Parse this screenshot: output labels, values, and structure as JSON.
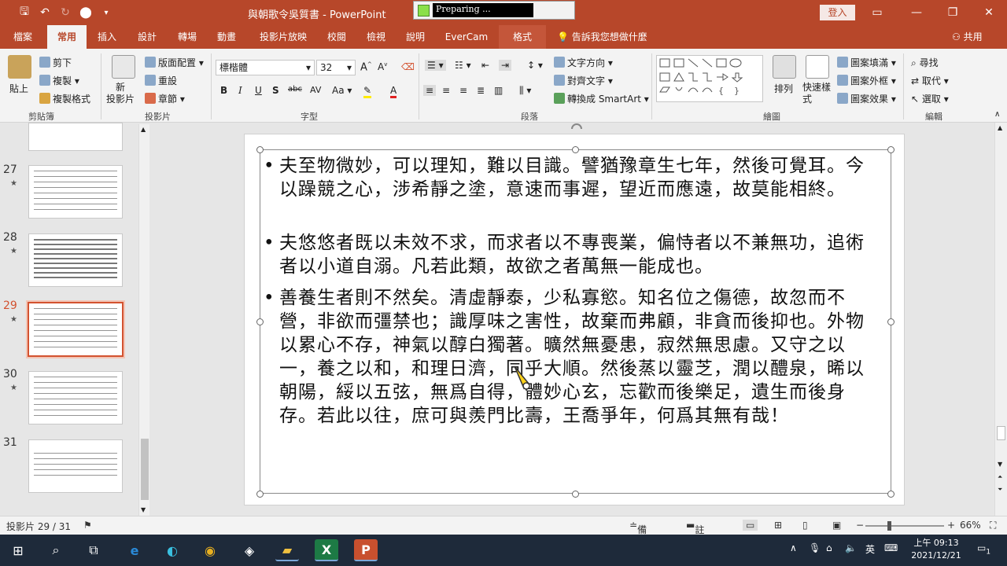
{
  "window": {
    "title": "與朝歌令吳質書 - PowerPoint",
    "preparing_text": "Preparing ...",
    "login_label": "登入"
  },
  "tabs": [
    {
      "label": "檔案"
    },
    {
      "label": "常用"
    },
    {
      "label": "插入"
    },
    {
      "label": "設計"
    },
    {
      "label": "轉場"
    },
    {
      "label": "動畫"
    },
    {
      "label": "投影片放映"
    },
    {
      "label": "校閱"
    },
    {
      "label": "檢視"
    },
    {
      "label": "說明"
    },
    {
      "label": "EverCam"
    },
    {
      "label": "格式"
    }
  ],
  "tell_me": "告訴我您想做什麼",
  "share_label": "共用",
  "ribbon": {
    "clipboard": {
      "paste": "貼上",
      "cut": "剪下",
      "copy": "複製",
      "format_painter": "複製格式",
      "label": "剪貼簿"
    },
    "slides": {
      "new_slide": "新\n投影片",
      "layout": "版面配置",
      "reset": "重設",
      "section": "章節",
      "label": "投影片"
    },
    "font": {
      "font_name": "標楷體",
      "font_size": "32",
      "label": "字型"
    },
    "paragraph": {
      "text_direction": "文字方向",
      "align_text": "對齊文字",
      "smartart": "轉換成 SmartArt",
      "label": "段落"
    },
    "drawing": {
      "arrange": "排列",
      "quick_styles": "快速樣式",
      "shape_fill": "圖案填滿",
      "shape_outline": "圖案外框",
      "shape_effects": "圖案效果",
      "label": "繪圖"
    },
    "editing": {
      "find": "尋找",
      "replace": "取代",
      "select": "選取",
      "label": "編輯"
    }
  },
  "slide_thumbnails": [
    {
      "number": "27",
      "star": "★"
    },
    {
      "number": "28",
      "star": "★"
    },
    {
      "number": "29",
      "star": "★"
    },
    {
      "number": "30",
      "star": "★"
    },
    {
      "number": "31",
      "star": ""
    }
  ],
  "slide": {
    "paragraphs": [
      {
        "bullet": "•",
        "text": "夫至物微妙，可以理知，難以目識。譬猶豫章生七年，然後可覺耳。今以躁競之心，涉希靜之塗，意速而事遲，望近而應遠，故莫能相終。"
      },
      {
        "bullet": "•",
        "text": "夫悠悠者既以未效不求，而求者以不專喪業，偏恃者以不兼無功，追術者以小道自溺。凡若此類，故欲之者萬無一能成也。"
      },
      {
        "bullet": "•",
        "text": "善養生者則不然矣。清虛靜泰，少私寡慾。知名位之傷德，故忽而不營，非欲而彊禁也；識厚味之害性，故棄而弗顧，非貪而後抑也。外物以累心不存，神氣以醇白獨著。曠然無憂患，寂然無思慮。又守之以一，養之以和，和理日濟，同乎大順。然後蒸以靈芝，潤以醴泉，晞以朝陽，綏以五弦，無爲自得，體妙心玄，忘歡而後樂足，遺生而後身存。若此以往，庶可與羨門比壽，王喬爭年，何爲其無有哉！"
      }
    ]
  },
  "statusbar": {
    "slide_count": "投影片 29 / 31",
    "notes": "備忘稿",
    "comments": "註解",
    "zoom": "66%"
  },
  "taskbar": {
    "ime": "英",
    "time": "上午 09:13",
    "date": "2021/12/21",
    "notification_count": "1"
  }
}
